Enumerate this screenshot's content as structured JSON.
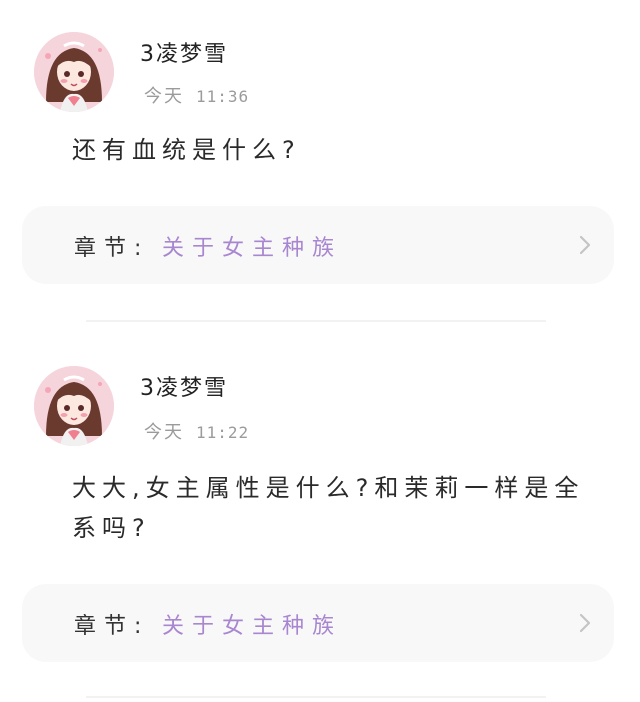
{
  "comments": [
    {
      "username": "3凌梦雪",
      "date_label": "今天",
      "time": "11:36",
      "text": "还有血统是什么?",
      "chapter_label": "章节:",
      "chapter_name": "关于女主种族"
    },
    {
      "username": "3凌梦雪",
      "date_label": "今天",
      "time": "11:22",
      "text": "大大,女主属性是什么?和茉莉一样是全系吗?",
      "chapter_label": "章节:",
      "chapter_name": "关于女主种族"
    }
  ],
  "colors": {
    "chapter_accent": "#a886d0",
    "card_background": "#f8f8f8",
    "timestamp": "#9b9b9b"
  },
  "icons": {
    "avatar": "anime-girl-avatar",
    "chapter_arrow": "chevron-right-icon"
  }
}
